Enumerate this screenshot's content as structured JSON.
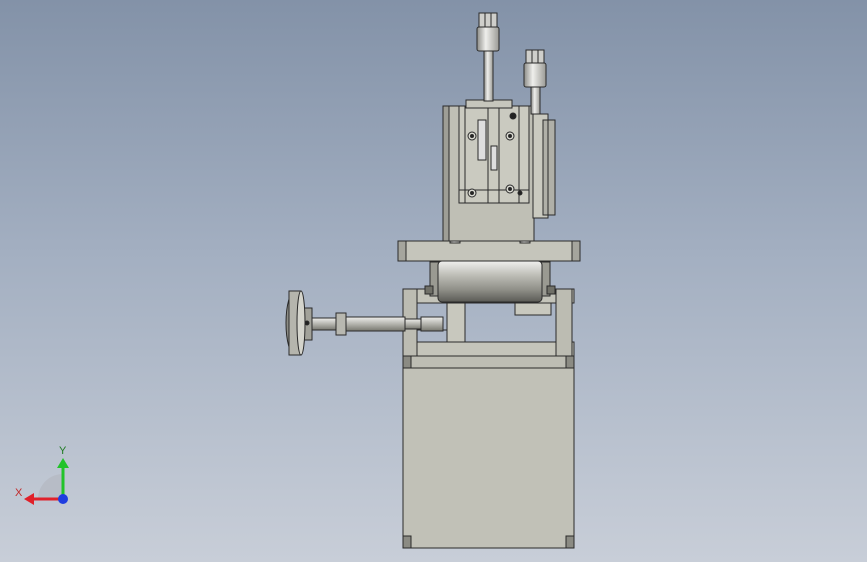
{
  "viewport": {
    "model": "machine-front-view"
  },
  "triad": {
    "x_label": "X",
    "y_label": "Y",
    "x_color": "#e0202a",
    "y_color": "#22c32a",
    "z_color": "#1f3de0"
  },
  "colors": {
    "part_fill": "#c2c2b8",
    "part_dark": "#9a9a90",
    "edge": "#2a2a2a",
    "rod": "#d9dada"
  }
}
